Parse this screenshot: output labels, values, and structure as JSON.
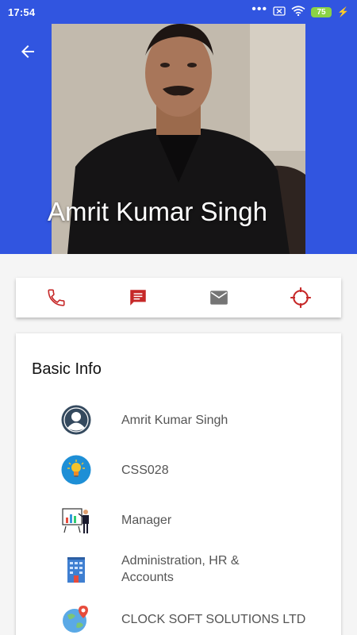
{
  "status_bar": {
    "time": "17:54",
    "battery": "75",
    "icons": [
      "more-dots-icon",
      "sim-blocked-icon",
      "wifi-icon",
      "battery-icon",
      "charging-icon"
    ]
  },
  "header": {
    "back_icon": "arrow-left-icon",
    "profile_name": "Amrit Kumar Singh",
    "colors": {
      "header_bg": "#3155e0"
    }
  },
  "actions": [
    {
      "name": "call",
      "icon": "phone-icon",
      "color": "#c62828"
    },
    {
      "name": "message",
      "icon": "message-icon",
      "color": "#c62828"
    },
    {
      "name": "email",
      "icon": "mail-icon",
      "color": "#757575"
    },
    {
      "name": "locate",
      "icon": "crosshair-icon",
      "color": "#c62828"
    }
  ],
  "basic_info": {
    "title": "Basic Info",
    "rows": [
      {
        "icon": "user-avatar-icon",
        "text": "Amrit Kumar Singh"
      },
      {
        "icon": "lightbulb-icon",
        "text": "CSS028"
      },
      {
        "icon": "presentation-icon",
        "text": "Manager"
      },
      {
        "icon": "building-icon",
        "text": "Administration, HR  &\nAccounts"
      },
      {
        "icon": "globe-location-icon",
        "text": "CLOCK SOFT SOLUTIONS LTD"
      }
    ]
  }
}
